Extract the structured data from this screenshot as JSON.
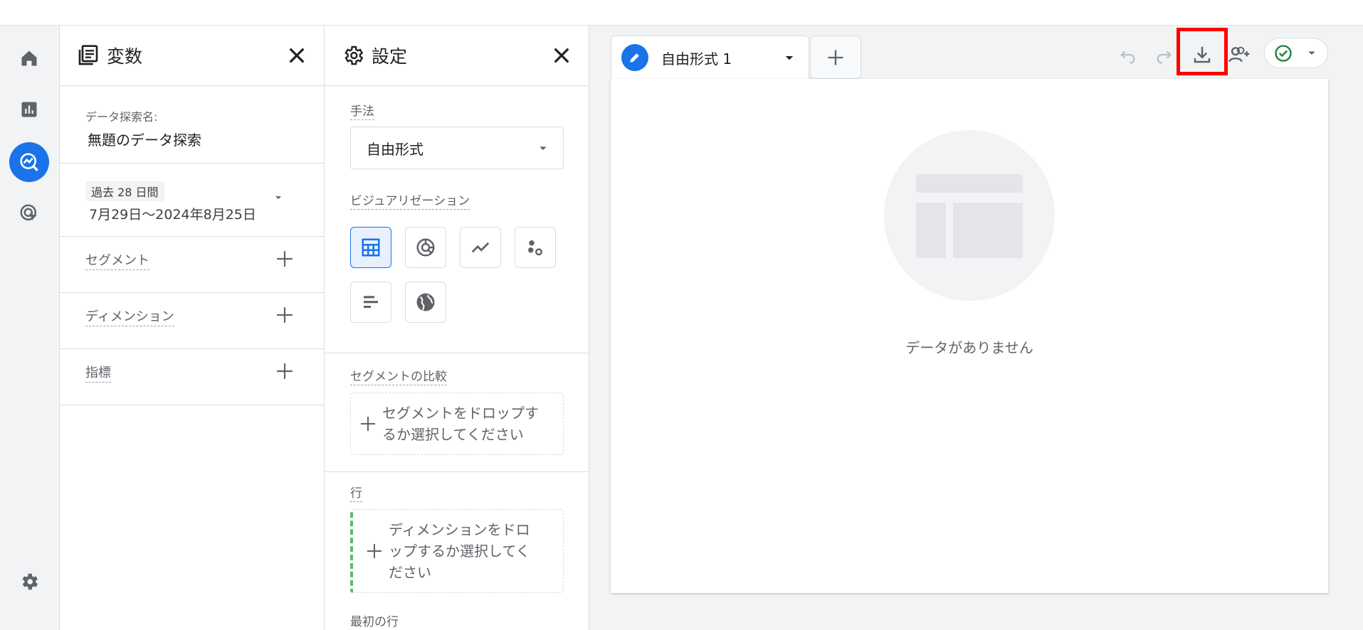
{
  "nav_rail": {
    "items": [
      {
        "icon": "home-icon"
      },
      {
        "icon": "reports-icon"
      },
      {
        "icon": "explore-icon"
      },
      {
        "icon": "advertising-icon"
      }
    ],
    "settings_icon": "gear-icon",
    "active_color": "#1a73e8"
  },
  "variables": {
    "title": "変数",
    "exploration_name_label": "データ探索名:",
    "exploration_name_value": "無題のデータ探索",
    "date_range": {
      "chip": "過去 28 日間",
      "range": "7月29日～2024年8月25日"
    },
    "sections": [
      {
        "label": "セグメント"
      },
      {
        "label": "ディメンション"
      },
      {
        "label": "指標"
      }
    ]
  },
  "settings": {
    "title": "設定",
    "technique_label": "手法",
    "technique_value": "自由形式",
    "visualization_label": "ビジュアリゼーション",
    "visualizations": [
      {
        "icon": "table-icon",
        "selected": true
      },
      {
        "icon": "donut-chart-icon",
        "selected": false
      },
      {
        "icon": "line-chart-icon",
        "selected": false
      },
      {
        "icon": "scatter-icon",
        "selected": false
      },
      {
        "icon": "bar-chart-icon",
        "selected": false
      },
      {
        "icon": "globe-icon",
        "selected": false
      }
    ],
    "segment_compare_label": "セグメントの比較",
    "segment_drop_line1": "セグメントをドロップす",
    "segment_drop_line2": "るか選択してください",
    "rows_label": "行",
    "rows_drop_line1": "ディメンションをドロ",
    "rows_drop_line2": "ップするか選択してく",
    "rows_drop_line3": "ださい",
    "first_row_label": "最初の行"
  },
  "canvas": {
    "tab_label": "自由形式 1",
    "empty_text": "データがありません",
    "toolbar": [
      "undo-icon",
      "redo-icon",
      "download-icon",
      "share-icon",
      "status-check-icon"
    ],
    "highlight_color": "#ff0000"
  }
}
